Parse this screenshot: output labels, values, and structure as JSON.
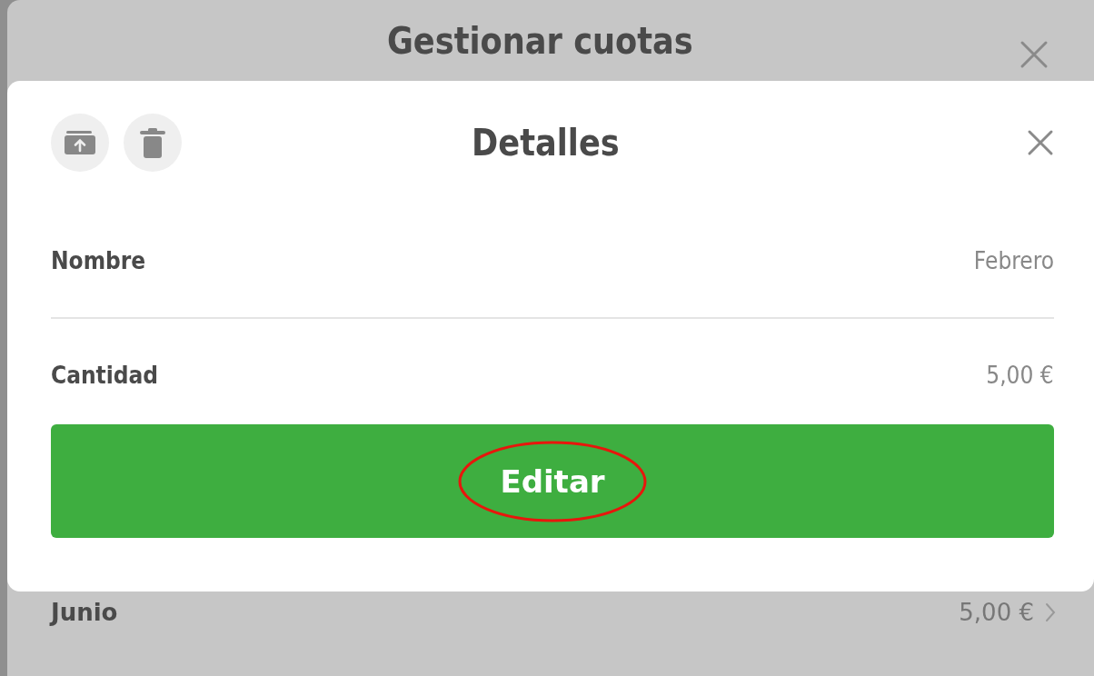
{
  "background_sheet": {
    "title": "Gestionar cuotas",
    "row": {
      "name": "Junio",
      "amount": "5,00 €"
    }
  },
  "modal": {
    "title": "Detalles",
    "fields": [
      {
        "label": "Nombre",
        "value": "Febrero"
      },
      {
        "label": "Cantidad",
        "value": "5,00 €"
      }
    ],
    "button": "Editar",
    "button_annotated": true
  }
}
